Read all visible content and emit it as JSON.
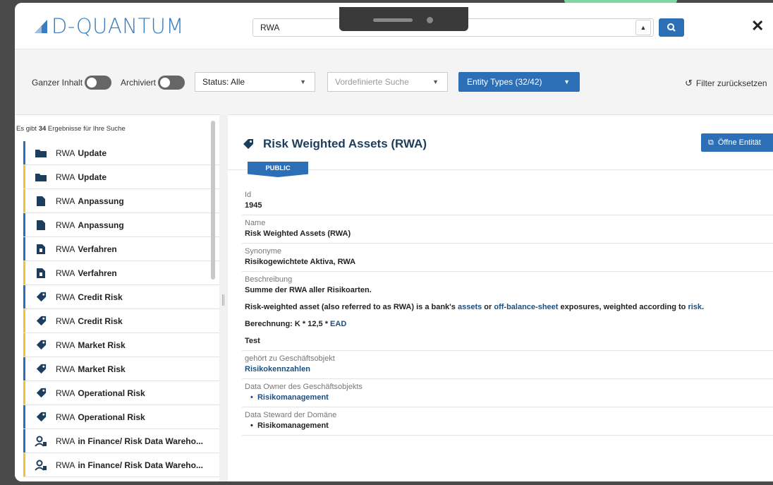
{
  "app": {
    "logo_text": "D-QUANTUM",
    "search_value": "RWA",
    "close_glyph": "✕"
  },
  "filters": {
    "ganzer_inhalt_label": "Ganzer Inhalt",
    "archiviert_label": "Archiviert",
    "status_value": "Status: Alle",
    "predefined_placeholder": "Vordefinierte Suche",
    "entity_types_label": "Entity Types (32/42)",
    "reset_label": "Filter zurücksetzen"
  },
  "sidebar": {
    "count_prefix": "Es gibt",
    "count_value": "34",
    "count_suffix": "Ergebnisse für Ihre Suche",
    "items": [
      {
        "prefix": "RWA",
        "label": "Update",
        "icon": "folder-icon",
        "accent": "#2d6fb7"
      },
      {
        "prefix": "RWA",
        "label": "Update",
        "icon": "folder-icon",
        "accent": "#f2c230"
      },
      {
        "prefix": "RWA",
        "label": "Anpassung",
        "icon": "document-icon",
        "accent": "#f2c230"
      },
      {
        "prefix": "RWA",
        "label": "Anpassung",
        "icon": "document-icon",
        "accent": "#2d6fb7"
      },
      {
        "prefix": "RWA",
        "label": "Verfahren",
        "icon": "procedure-icon",
        "accent": "#2d6fb7"
      },
      {
        "prefix": "RWA",
        "label": "Verfahren",
        "icon": "procedure-icon",
        "accent": "#f2c230"
      },
      {
        "prefix": "RWA",
        "label": "Credit Risk",
        "icon": "tag-icon",
        "accent": "#2d6fb7"
      },
      {
        "prefix": "RWA",
        "label": "Credit Risk",
        "icon": "tag-icon",
        "accent": "#f2c230"
      },
      {
        "prefix": "RWA",
        "label": "Market Risk",
        "icon": "tag-icon",
        "accent": "#f2c230"
      },
      {
        "prefix": "RWA",
        "label": "Market Risk",
        "icon": "tag-icon",
        "accent": "#2d6fb7"
      },
      {
        "prefix": "RWA",
        "label": "Operational Risk",
        "icon": "tag-icon",
        "accent": "#f2c230"
      },
      {
        "prefix": "RWA",
        "label": "Operational Risk",
        "icon": "tag-icon",
        "accent": "#2d6fb7"
      },
      {
        "prefix": "RWA",
        "label": "in Finance/ Risk Data Wareho...",
        "icon": "people-icon",
        "accent": "#2d6fb7"
      },
      {
        "prefix": "RWA",
        "label": "in Finance/ Risk Data Wareho...",
        "icon": "people-icon",
        "accent": "#f2c230"
      }
    ]
  },
  "detail": {
    "title": "Risk Weighted Assets (RWA)",
    "open_button": "Öffne Entität",
    "badge": "PUBLIC",
    "id_label": "Id",
    "id_value": "1945",
    "name_label": "Name",
    "name_value": "Risk Weighted Assets (RWA)",
    "synonyme_label": "Synonyme",
    "synonyme_value": "Risikogewichtete Aktiva, RWA",
    "beschreibung_label": "Beschreibung",
    "beschreibung_value": "Summe der RWA aller Risikoarten.",
    "desc_part1": "Risk-weighted asset (also referred to as RWA) is a bank's",
    "desc_link1": "assets",
    "desc_part2": "or",
    "desc_link2": "off-balance-sheet",
    "desc_part3": "exposures, weighted according to",
    "desc_link3": "risk",
    "desc_end": ".",
    "berechnung_text": "Berechnung: K * 12,5 *",
    "berechnung_link": "EAD",
    "test_text": "Test",
    "geschaeftsobjekt_label": "gehört zu Geschäftsobjekt",
    "geschaeftsobjekt_value": "Risikokennzahlen",
    "owner_label": "Data Owner des Geschäftsobjekts",
    "owner_value": "Risikomanagement",
    "steward_label": "Data Steward der Domäne",
    "steward_value": "Risikomanagement"
  }
}
